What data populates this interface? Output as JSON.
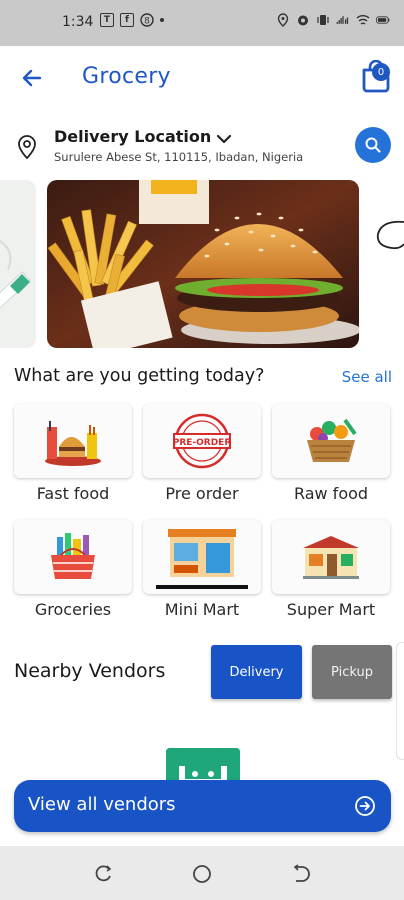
{
  "status_bar": {
    "time": "1:34",
    "left_icons": [
      "notification-t-icon",
      "facebook-icon",
      "currency-icon",
      "dot-icon"
    ],
    "right_icons": [
      "location-icon",
      "alarm-icon",
      "vibrate-icon",
      "signal-icon",
      "wifi-icon",
      "battery-icon"
    ]
  },
  "header": {
    "title": "Grocery",
    "cart_count": "0"
  },
  "location": {
    "title": "Delivery Location",
    "address": "Surulere Abese St, 110115, Ibadan, Nigeria"
  },
  "categories_section": {
    "title": "What are you getting today?",
    "see_all": "See all",
    "items": [
      {
        "label": "Fast food",
        "badge_text": ""
      },
      {
        "label": "Pre order",
        "badge_text": "PRE-ORDER"
      },
      {
        "label": "Raw food",
        "badge_text": ""
      },
      {
        "label": "Groceries",
        "badge_text": ""
      },
      {
        "label": "Mini Mart",
        "badge_text": ""
      },
      {
        "label": "Super Mart",
        "badge_text": ""
      }
    ]
  },
  "vendors": {
    "title": "Nearby Vendors",
    "delivery_label": "Delivery",
    "pickup_label": "Pickup",
    "view_all_label": "View all vendors"
  },
  "colors": {
    "primary": "#1954c6",
    "accent": "#2573d8",
    "status_bar_bg": "#c9c9c9",
    "pickup_bg": "#757575",
    "nav_bar_bg": "#eaeaea"
  }
}
